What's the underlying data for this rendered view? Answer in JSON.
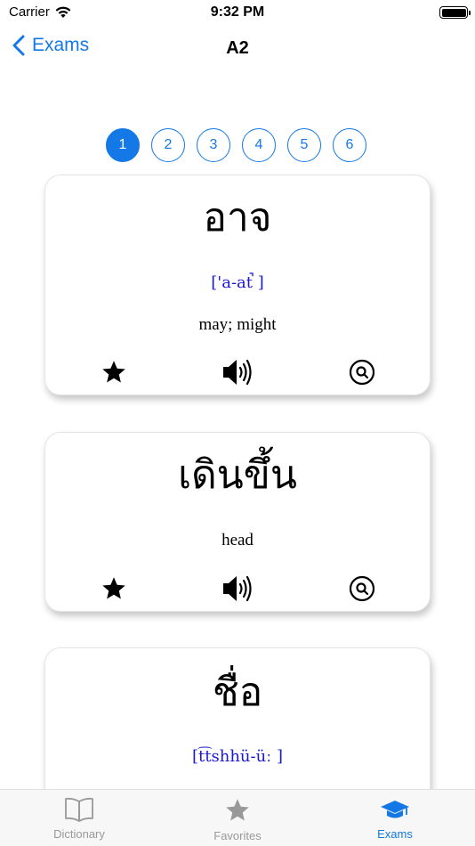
{
  "status_bar": {
    "carrier": "Carrier",
    "time": "9:32 PM"
  },
  "nav": {
    "back_label": "Exams",
    "title": "A2"
  },
  "pager": {
    "pages": [
      "1",
      "2",
      "3",
      "4",
      "5",
      "6"
    ],
    "selected": "1"
  },
  "cards": [
    {
      "word": "อาจ",
      "phonetic": "['a-at̚ ]",
      "meaning": "may; might"
    },
    {
      "word": "เดินขึ้น",
      "phonetic": "",
      "meaning": "head"
    },
    {
      "word": "ชื่อ",
      "phonetic": "[t͡tshhü-üː ]",
      "meaning": ""
    }
  ],
  "card_icons": [
    "star-icon",
    "speaker-icon",
    "search-icon"
  ],
  "tab_bar": {
    "tabs": [
      {
        "label": "Dictionary",
        "icon": "book-icon"
      },
      {
        "label": "Favorites",
        "icon": "star-icon"
      },
      {
        "label": "Exams",
        "icon": "graduation-cap-icon"
      }
    ],
    "selected": "Exams"
  },
  "colors": {
    "accent": "#1478e6",
    "phonetic": "#1a1ad6",
    "inactive_tab": "#999999"
  }
}
